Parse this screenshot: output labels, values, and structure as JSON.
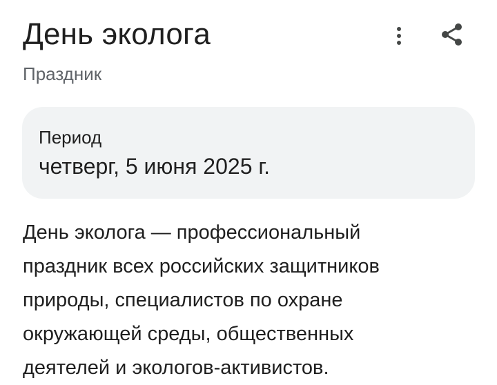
{
  "header": {
    "title": "День эколога",
    "subtitle": "Праздник",
    "more_icon": "more-vert-icon",
    "share_icon": "share-icon"
  },
  "period_card": {
    "label": "Период",
    "value": "четверг, 5 июня 2025 г."
  },
  "description": {
    "lines": [
      "День эколога — профессиональный",
      "праздник всех российских защитников",
      "природы, специалистов по охране",
      "окружающей среды, общественных",
      "деятелей и экологов-активистов."
    ]
  },
  "colors": {
    "text_primary": "#1f1f1f",
    "text_secondary": "#5f6368",
    "card_background": "#f1f3f4",
    "icon": "#444746"
  }
}
